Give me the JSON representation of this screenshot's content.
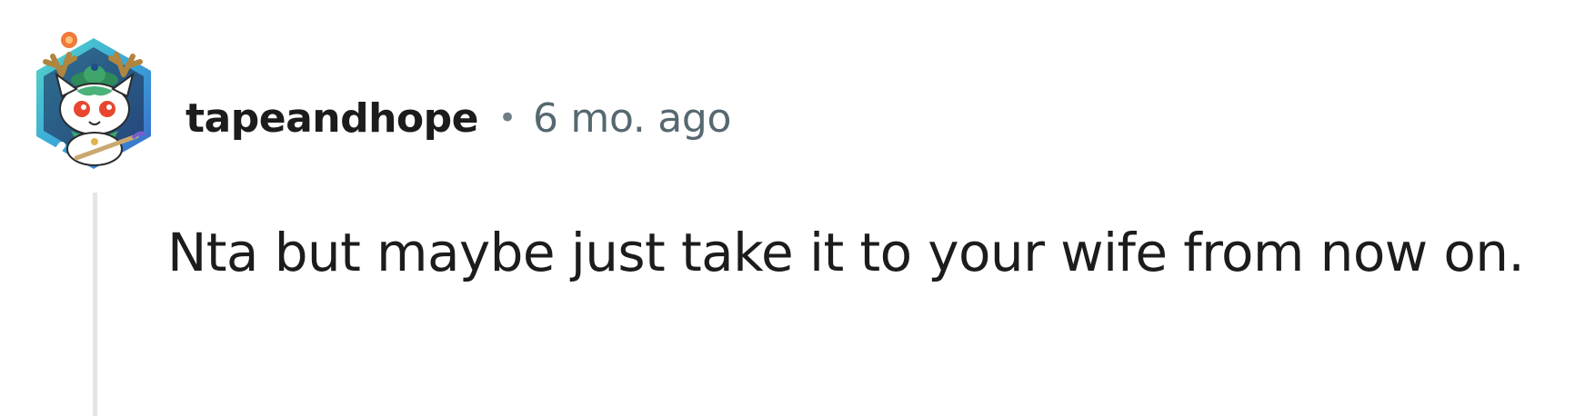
{
  "comment": {
    "avatar_icon": "snoo-avatar-icon",
    "username": "tapeandhope",
    "separator": "•",
    "timestamp": "6 mo. ago",
    "body": "Nta but maybe just take it to your wife from now on."
  },
  "colors": {
    "text": "#1c1c1c",
    "meta": "#566870",
    "thread_line": "#e3e6e8",
    "avatar_border_teal": "#4fd1c5",
    "avatar_border_blue": "#3d6fd6"
  }
}
